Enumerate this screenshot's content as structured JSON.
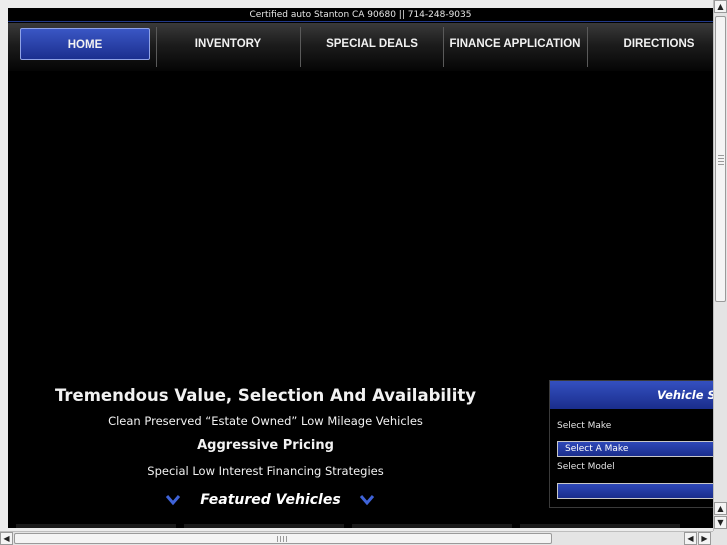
{
  "topbar": {
    "text": "Certified auto  Stanton CA 90680 || 714-248-9035"
  },
  "nav": {
    "items": [
      {
        "label": "HOME",
        "active": true
      },
      {
        "label": "INVENTORY"
      },
      {
        "label": "SPECIAL DEALS"
      },
      {
        "label": "FINANCE APPLICATION"
      },
      {
        "label": "DIRECTIONS"
      }
    ]
  },
  "hero": {
    "title": "Tremendous Value, Selection And Availability",
    "subtitle1": "Clean Preserved “Estate Owned” Low Mileage Vehicles",
    "title2": "Aggressive Pricing",
    "subtitle2": "Special Low Interest Financing Strategies",
    "featured_label": "Featured Vehicles"
  },
  "vehicle_search": {
    "title": "Vehicle S",
    "make_label": "Select Make",
    "make_value": "Select A Make",
    "model_label": "Select Model",
    "model_value": ""
  },
  "icons": {
    "chevron": "chevron-down-icon",
    "scroll_up": "arrow-up-icon",
    "scroll_down": "arrow-down-icon",
    "scroll_left": "arrow-left-icon",
    "scroll_right": "arrow-right-icon"
  },
  "colors": {
    "accent": "#2a45b5",
    "background": "#000000",
    "text": "#f2f2f2"
  }
}
